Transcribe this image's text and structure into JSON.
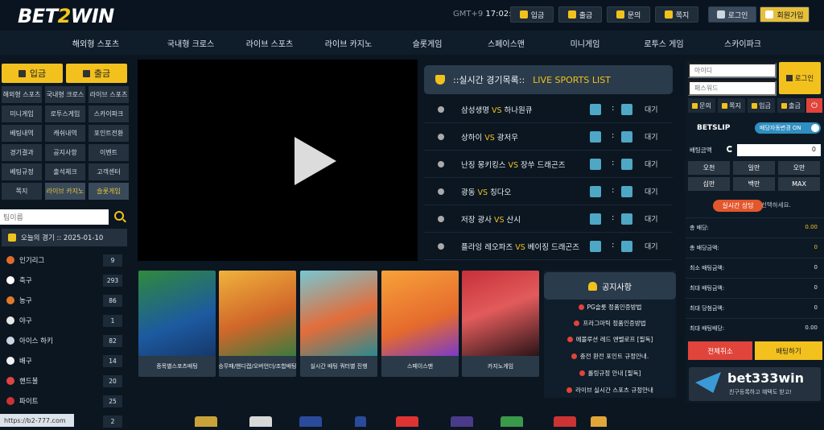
{
  "header": {
    "logo_part1": "BET",
    "logo_part2": "2",
    "logo_part3": "WIN",
    "timezone": "GMT+9",
    "time": "17:02:07",
    "buttons": [
      "입금",
      "출금",
      "문의",
      "쪽지",
      "로그인",
      "회원가입"
    ]
  },
  "nav": [
    "해외형 스포츠",
    "국내형 크로스",
    "라이브 스포츠",
    "라이브 카지노",
    "슬롯게임",
    "스페이스맨",
    "미니게임",
    "로투스 게임",
    "스카이파크"
  ],
  "left": {
    "deposit": "입금",
    "withdraw": "출금",
    "menu": [
      "해외형 스포츠",
      "국내형 크로스",
      "라이브 스포츠",
      "미니게임",
      "로투스게임",
      "스카이파크",
      "베팅내역",
      "캐쉬내역",
      "포인트전환",
      "경기결과",
      "공지사항",
      "이벤트",
      "베팅규정",
      "출석체크",
      "고객센터",
      "쪽지",
      "라이브 카지노",
      "슬롯게임"
    ],
    "search_placeholder": "팀이름",
    "today": "오늘의 경기 :: 2025-01-10",
    "sports": [
      {
        "name": "인기리그",
        "count": "9"
      },
      {
        "name": "축구",
        "count": "293"
      },
      {
        "name": "농구",
        "count": "86"
      },
      {
        "name": "야구",
        "count": "1"
      },
      {
        "name": "아이스 하키",
        "count": "82"
      },
      {
        "name": "배구",
        "count": "14"
      },
      {
        "name": "핸드볼",
        "count": "20"
      },
      {
        "name": "파이트",
        "count": "25"
      },
      {
        "name": "",
        "count": "2"
      }
    ]
  },
  "live": {
    "title1": "::실시간 경기목록::",
    "title2": "LIVE SPORTS LIST",
    "vs": "VS",
    "colon": ":",
    "matches": [
      {
        "home": "삼성생명",
        "away": "하나원큐",
        "status": "대기"
      },
      {
        "home": "상하이",
        "away": "광저우",
        "status": "대기"
      },
      {
        "home": "난징 몽키킹스",
        "away": "장쑤 드래곤즈",
        "status": "대기"
      },
      {
        "home": "광동",
        "away": "칭다오",
        "status": "대기"
      },
      {
        "home": "저장 광사",
        "away": "산시",
        "status": "대기"
      },
      {
        "home": "플라잉 레오파즈",
        "away": "베이징 드래곤즈",
        "status": "대기"
      }
    ]
  },
  "cards": [
    "종목별스포츠배팅",
    "승무패/핸디캡/오버언더/조합배팅",
    "실시간 배팅 쿼터별 진행",
    "스페이스맨",
    "카지노게임"
  ],
  "notice": {
    "title": "공지사항",
    "items": [
      "PG슬롯 정품인증방법",
      "프라그마틱 정품인증방법",
      "에볼루션 레드 앤벨로프 [필독]",
      "충전 환전 포인트 규정안내.",
      "롤링규정 안내 [필독]",
      "라이브 실시간 스포츠 규정안내"
    ]
  },
  "url": "https://b2-777.com",
  "right": {
    "id_placeholder": "아이디",
    "pw_placeholder": "패스워드",
    "login": "로그인",
    "bar": [
      "문의",
      "쪽지",
      "입금",
      "출금"
    ],
    "betslip": "BETSLIP",
    "auto_change": "배당자동변경 ON",
    "bet_amount_label": "배팅금액",
    "bet_amount_value": "0",
    "chips": [
      "오천",
      "일만",
      "오만",
      "십만",
      "백만",
      "MAX"
    ],
    "consult": "실시간 상담",
    "consult_suffix": "선택하세요.",
    "lines": [
      {
        "label": "총 배당:",
        "value": "0.00",
        "yellow": true
      },
      {
        "label": "총 배당금액:",
        "value": "0"
      },
      {
        "label": "최소 배팅금액:",
        "value": "0"
      },
      {
        "label": "최대 배팅금액:",
        "value": "0"
      },
      {
        "label": "최대 당첨금액:",
        "value": "0"
      },
      {
        "label": "최대 배팅배당:",
        "value": "0.00"
      }
    ],
    "cancel_all": "전체취소",
    "place_bet": "배팅하기",
    "promo_title": "bet333win",
    "promo_sub": "친구등록하고 혜택도 받고!"
  }
}
